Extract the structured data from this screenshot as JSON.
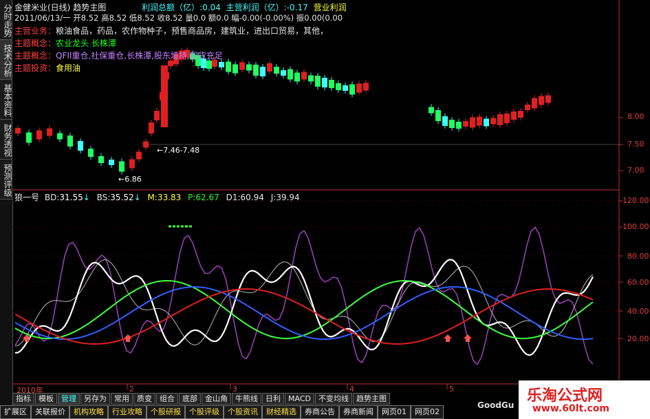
{
  "side_tabs": [
    "分时走势",
    "技术分析",
    "基本资料",
    "财务透视",
    "预测评级"
  ],
  "info": {
    "line1": {
      "name": "金健米业(日线)",
      "chart": "趋势主图",
      "profit_total_label": "利润总额（亿）:",
      "profit_total": "0.04",
      "main_profit_label": "主营利润（亿）:",
      "main_profit": "-0.17",
      "extra": "营业利润"
    },
    "line2": "2011/06/13/一 开8.52 高8.52 低8.52 收8.52 量0.0 额0.0 幅-0.00(-0.00%) 振0.00(0.00",
    "line3_label": "主营业务：",
    "line3": "粮油食品，药品，农作物种子，预售商品房，建筑业，进出口贸易，其他，",
    "line4_label": "主题概念：",
    "line4": "农业龙头 长株潭",
    "line5_label": "主题概念：",
    "line5": "QFII重仓,社保重仓,长株潭,股东增持,现货充足",
    "line6_label": "主题投资：",
    "line6": "食用油"
  },
  "price_annotations": {
    "high": "7.46-7.48",
    "low": "6.86"
  },
  "price_axis": [
    "8.00",
    "7.50",
    "7.00"
  ],
  "indicator": {
    "name": "狼一号",
    "bd_label": "BD:",
    "bd": "31.55",
    "bs_label": "BS:",
    "bs": "35.52",
    "m_label": "M:",
    "m": "33.83",
    "p_label": "P:",
    "p": "62.67",
    "d1_label": "D1:",
    "d1": "60.94",
    "j_label": "J:",
    "j": "39.94"
  },
  "indicator_axis": [
    "120.00",
    "100.00",
    "80.00",
    "60.00",
    "40.00",
    "20.00"
  ],
  "time_labels": [
    "2010年",
    "2",
    "3",
    "4",
    "5"
  ],
  "tabs": [
    "指标",
    "模板",
    "管理",
    "另存为",
    "常用",
    "质变",
    "组合",
    "底部",
    "金山角",
    "牛熊线",
    "日利",
    "MACD",
    "不变均线",
    "趋势主图"
  ],
  "active_tab": "管理",
  "bottom_tabs": [
    "扩展区",
    "关联报价",
    "机构攻略",
    "行业攻略",
    "个股研报",
    "个股评级",
    "个股资讯",
    "财经精选",
    "券商公告",
    "券商新闻",
    "网页01",
    "网页02"
  ],
  "watermark": {
    "title": "乐淘公式网",
    "url": "www.60lt.com",
    "brand": "GoodGu"
  },
  "colors": {
    "up": "#e02020",
    "down_fill": "#20ff60",
    "down_cyan": "#40ffff",
    "line_blue": "#3060ff",
    "line_red": "#e02020",
    "line_green": "#40ff40",
    "line_purple": "#a040c0",
    "axis": "#e04040"
  }
}
